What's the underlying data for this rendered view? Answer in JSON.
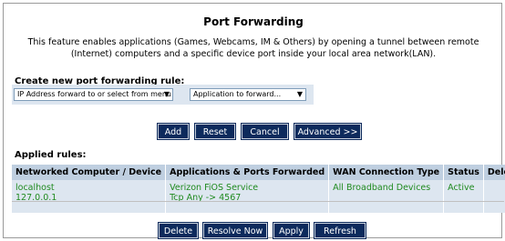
{
  "page": {
    "title": "Port Forwarding",
    "description": "This feature enables applications (Games, Webcams, IM & Others) by opening a tunnel between remote (Internet) computers and a specific device port inside your local area network(LAN)."
  },
  "create": {
    "label": "Create new port forwarding rule:",
    "ip_select": "IP Address forward to or select from menu",
    "app_select": "Application to forward..."
  },
  "actions": {
    "add": "Add",
    "reset": "Reset",
    "cancel": "Cancel",
    "advanced": "Advanced >>"
  },
  "applied": {
    "label": "Applied rules:",
    "columns": [
      "Networked Computer / Device",
      "Applications & Ports Forwarded",
      "WAN Connection Type",
      "Status",
      "Delete"
    ],
    "rows": [
      {
        "computer": "localhost",
        "ip": "127.0.0.1",
        "app": "Verizon FiOS Service",
        "ports": "Tcp Any -> 4567",
        "wan": "All Broadband Devices",
        "status": "Active",
        "delete": ""
      }
    ]
  },
  "bottom": {
    "delete": "Delete",
    "resolve": "Resolve Now",
    "apply": "Apply",
    "refresh": "Refresh"
  },
  "colors": {
    "button_bg": "#0d2a5c",
    "panel_bg": "#dde6f0",
    "header_bg": "#bfcfe0",
    "value_text": "#1f8a1f"
  }
}
